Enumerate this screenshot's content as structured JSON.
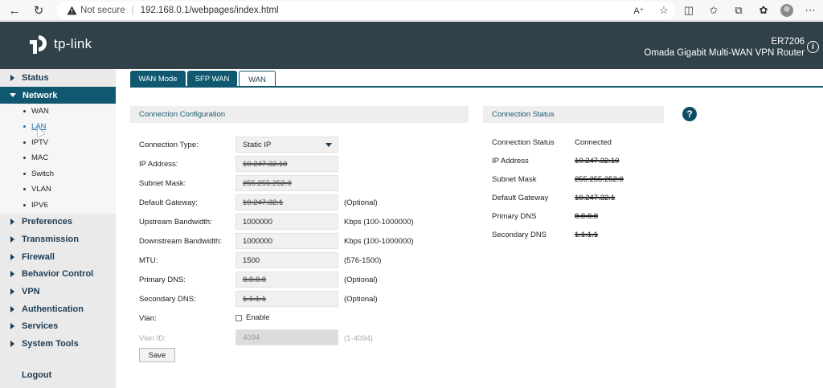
{
  "browser": {
    "security_label": "Not secure",
    "url": "192.168.0.1/webpages/index.html"
  },
  "header": {
    "brand": "tp-link",
    "model": "ER7206",
    "description": "Omada Gigabit Multi-WAN VPN Router"
  },
  "sidebar": {
    "menus": [
      {
        "label": "Status",
        "active": false
      },
      {
        "label": "Network",
        "active": true
      },
      {
        "label": "Preferences",
        "active": false
      },
      {
        "label": "Transmission",
        "active": false
      },
      {
        "label": "Firewall",
        "active": false
      },
      {
        "label": "Behavior Control",
        "active": false
      },
      {
        "label": "VPN",
        "active": false
      },
      {
        "label": "Authentication",
        "active": false
      },
      {
        "label": "Services",
        "active": false
      },
      {
        "label": "System Tools",
        "active": false
      }
    ],
    "network_submenu": [
      "WAN",
      "LAN",
      "IPTV",
      "MAC",
      "Switch",
      "VLAN",
      "IPV6"
    ],
    "hovered_submenu": "LAN",
    "logout": "Logout"
  },
  "tabs": [
    {
      "label": "WAN Mode",
      "selected": false
    },
    {
      "label": "SFP WAN",
      "selected": false
    },
    {
      "label": "WAN",
      "selected": true
    }
  ],
  "config": {
    "title": "Connection Configuration",
    "fields": [
      {
        "label": "Connection Type:",
        "value": "Static IP",
        "hint": ""
      },
      {
        "label": "IP Address:",
        "value": "10.247.32.10",
        "hint": ""
      },
      {
        "label": "Subnet Mask:",
        "value": "255.255.252.0",
        "hint": ""
      },
      {
        "label": "Default Gateway:",
        "value": "10.247.32.1",
        "hint": "(Optional)"
      },
      {
        "label": "Upstream Bandwidth:",
        "value": "1000000",
        "hint": "Kbps (100-1000000)"
      },
      {
        "label": "Downstream Bandwidth:",
        "value": "1000000",
        "hint": "Kbps (100-1000000)"
      },
      {
        "label": "MTU:",
        "value": "1500",
        "hint": "(576-1500)"
      },
      {
        "label": "Primary DNS:",
        "value": "8.8.8.8",
        "hint": "(Optional)"
      },
      {
        "label": "Secondary DNS:",
        "value": "1.1.1.1",
        "hint": "(Optional)"
      }
    ],
    "vlan_label": "Vlan:",
    "vlan_enable": "Enable",
    "vlan_enabled": false,
    "vlan_id_label": "Vlan ID:",
    "vlan_id_value": "4094",
    "vlan_id_hint": "(1-4094)",
    "save": "Save"
  },
  "status": {
    "title": "Connection Status",
    "rows": [
      {
        "label": "Connection Status",
        "value": "Connected"
      },
      {
        "label": "IP Address",
        "value": "10.247.32.10"
      },
      {
        "label": "Subnet Mask",
        "value": "255.255.252.0"
      },
      {
        "label": "Default Gateway",
        "value": "10.247.32.1"
      },
      {
        "label": "Primary DNS",
        "value": "8.8.8.8"
      },
      {
        "label": "Secondary DNS",
        "value": "1.1.1.1"
      }
    ]
  },
  "help": "?",
  "colors": {
    "header_bg": "#304149",
    "accent": "#0f5870",
    "sidebar_bg": "#eaeaea"
  }
}
